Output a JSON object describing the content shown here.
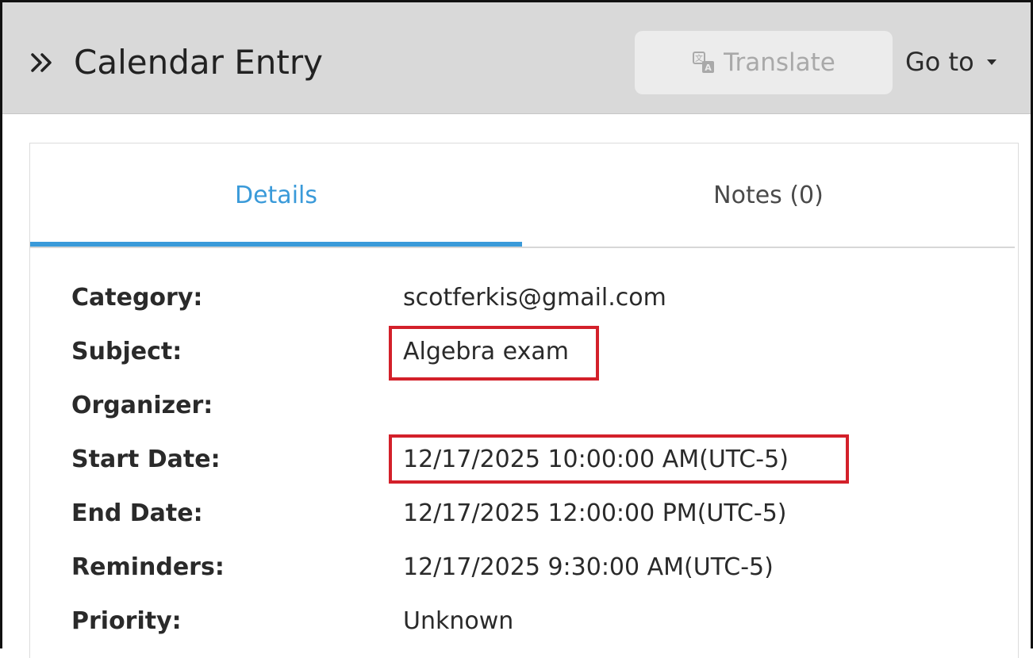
{
  "header": {
    "title": "Calendar Entry",
    "translate_label": "Translate",
    "goto_label": "Go to"
  },
  "tabs": [
    {
      "label": "Details",
      "active": true
    },
    {
      "label": "Notes (0)",
      "active": false
    }
  ],
  "details": [
    {
      "label": "Category:",
      "value": "scotferkis@gmail.com"
    },
    {
      "label": "Subject:",
      "value": "Algebra exam",
      "highlighted": true
    },
    {
      "label": "Organizer:",
      "value": ""
    },
    {
      "label": "Start Date:",
      "value": "12/17/2025 10:00:00 AM(UTC-5)",
      "highlighted": true
    },
    {
      "label": "End Date:",
      "value": "12/17/2025 12:00:00 PM(UTC-5)"
    },
    {
      "label": "Reminders:",
      "value": "12/17/2025 9:30:00 AM(UTC-5)"
    },
    {
      "label": "Priority:",
      "value": "Unknown"
    }
  ],
  "colors": {
    "accent": "#3a9ad9",
    "highlight_box": "#d3202a",
    "header_bg": "#d9d9d9",
    "disabled_text": "#a9a9a9"
  },
  "icons": {
    "collapse": "double-chevron-right-icon",
    "translate": "translate-icon",
    "goto_caret": "caret-down-icon"
  }
}
